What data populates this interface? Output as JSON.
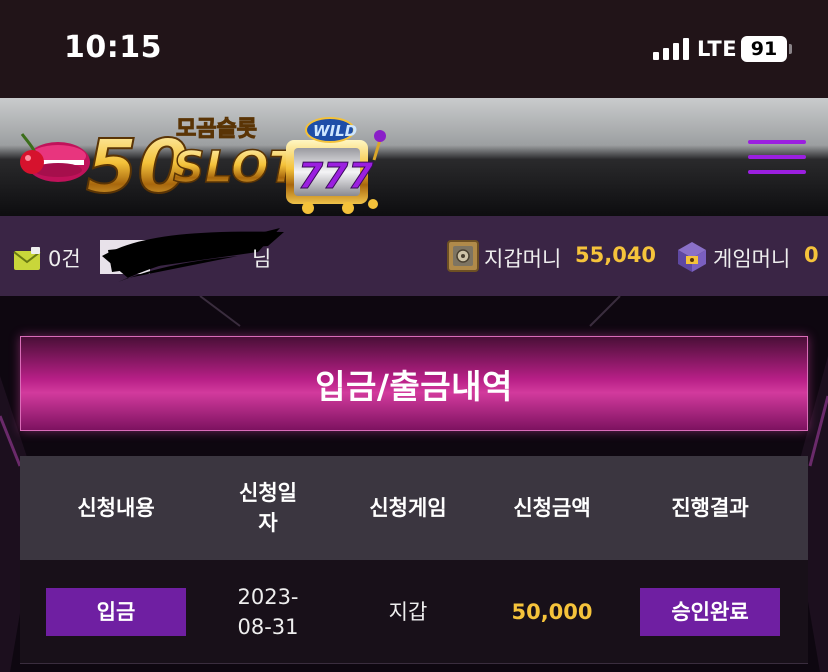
{
  "status_bar": {
    "time": "10:15",
    "network": "LTE",
    "battery": "91"
  },
  "header": {
    "logo": {
      "text_small": "모곰슬롯",
      "text_number": "50",
      "text_big": "SLOT",
      "badge_text": "WILD",
      "reels": "777"
    },
    "menu_icon": "hamburger-menu-icon",
    "accent_color": "#9b1fe0"
  },
  "info_bar": {
    "mail_icon": "envelope-icon",
    "mail_count": "0건",
    "user_suffix": "님",
    "wallet_icon": "safe-icon",
    "wallet_label": "지갑머니",
    "wallet_value": "55,040",
    "game_icon": "treasure-box-icon",
    "game_label": "게임머니",
    "game_value": "0",
    "value_color": "#f5c33b"
  },
  "page": {
    "title": "입금/출금내역"
  },
  "table": {
    "headers": [
      "신청내용",
      "신청일\n자",
      "신청게임",
      "신청금액",
      "진행결과"
    ],
    "rows": [
      {
        "type": "입금",
        "date": "2023-\n08-31",
        "game": "지갑",
        "amount": "50,000",
        "status": "승인완료"
      }
    ]
  }
}
